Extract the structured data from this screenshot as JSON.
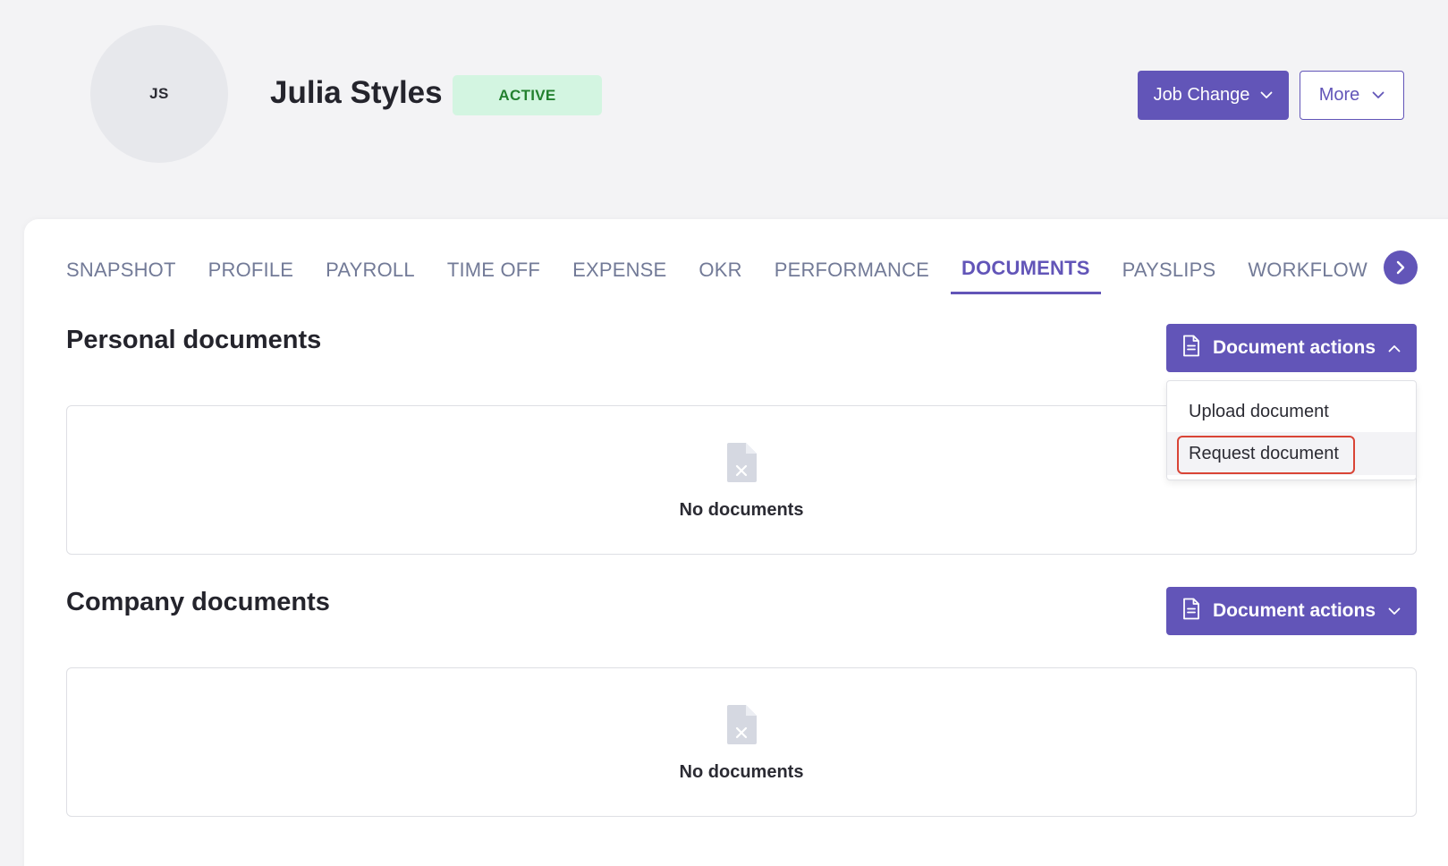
{
  "header": {
    "avatar_initials": "JS",
    "name": "Julia Styles",
    "status": "ACTIVE",
    "job_change_label": "Job Change",
    "more_label": "More"
  },
  "tabs": [
    {
      "label": "SNAPSHOT",
      "active": false
    },
    {
      "label": "PROFILE",
      "active": false
    },
    {
      "label": "PAYROLL",
      "active": false
    },
    {
      "label": "TIME OFF",
      "active": false
    },
    {
      "label": "EXPENSE",
      "active": false
    },
    {
      "label": "OKR",
      "active": false
    },
    {
      "label": "PERFORMANCE",
      "active": false
    },
    {
      "label": "DOCUMENTS",
      "active": true
    },
    {
      "label": "PAYSLIPS",
      "active": false
    },
    {
      "label": "WORKFLOW",
      "active": false
    }
  ],
  "personal": {
    "title": "Personal documents",
    "actions_label": "Document actions",
    "empty_text": "No documents"
  },
  "company": {
    "title": "Company documents",
    "actions_label": "Document actions",
    "empty_text": "No documents"
  },
  "dropdown": {
    "items": [
      "Upload document",
      "Request document"
    ]
  },
  "colors": {
    "accent": "#6255b8",
    "status_bg": "#d3f5e1",
    "status_text": "#23812f",
    "highlight": "#d94436"
  }
}
